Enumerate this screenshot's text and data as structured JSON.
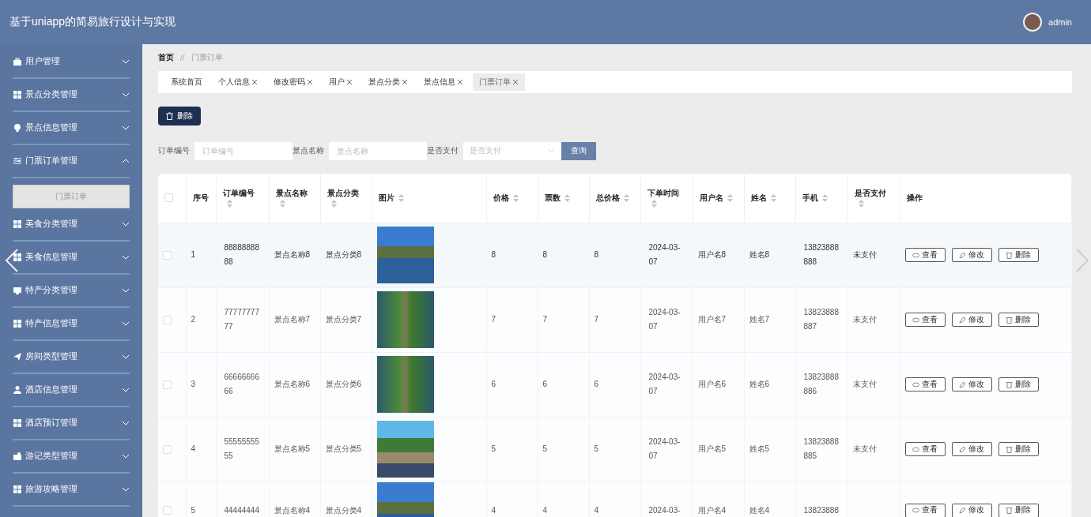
{
  "header": {
    "title": "基于uniapp的简易旅行设计与实现",
    "user": "admin"
  },
  "sidebar": {
    "items": [
      {
        "label": "用户管理",
        "expanded": false
      },
      {
        "label": "景点分类管理",
        "expanded": false
      },
      {
        "label": "景点信息管理",
        "expanded": false
      },
      {
        "label": "门票订单管理",
        "expanded": true,
        "children": [
          {
            "label": "门票订单",
            "selected": true
          }
        ]
      },
      {
        "label": "美食分类管理",
        "expanded": false
      },
      {
        "label": "美食信息管理",
        "expanded": false
      },
      {
        "label": "特产分类管理",
        "expanded": false
      },
      {
        "label": "特产信息管理",
        "expanded": false
      },
      {
        "label": "房间类型管理",
        "expanded": false
      },
      {
        "label": "酒店信息管理",
        "expanded": false
      },
      {
        "label": "酒店预订管理",
        "expanded": false
      },
      {
        "label": "游记类型管理",
        "expanded": false
      },
      {
        "label": "旅游攻略管理",
        "expanded": false
      }
    ]
  },
  "breadcrumb": [
    "首页",
    "门票订单"
  ],
  "breadcrumb_separator": "//",
  "tabs": [
    {
      "label": "系统首页",
      "closable": false,
      "selected": false
    },
    {
      "label": "个人信息",
      "closable": true,
      "selected": false
    },
    {
      "label": "修改密码",
      "closable": true,
      "selected": false
    },
    {
      "label": "用户",
      "closable": true,
      "selected": false
    },
    {
      "label": "景点分类",
      "closable": true,
      "selected": false
    },
    {
      "label": "景点信息",
      "closable": true,
      "selected": false
    },
    {
      "label": "门票订单",
      "closable": true,
      "selected": true
    }
  ],
  "delete_button": "删除",
  "filters": [
    {
      "label": "订单编号",
      "placeholder": "订单编号",
      "kind": "input"
    },
    {
      "label": "景点名称",
      "placeholder": "景点名称",
      "kind": "input"
    },
    {
      "label": "是否支付",
      "placeholder": "是否支付",
      "kind": "select"
    }
  ],
  "search_button": "查询",
  "table": {
    "select_all_checked": false,
    "columns": [
      {
        "label": "序号",
        "sortable": false
      },
      {
        "label": "订单编号",
        "sortable": true
      },
      {
        "label": "景点名称",
        "sortable": true
      },
      {
        "label": "景点分类",
        "sortable": true
      },
      {
        "label": "图片",
        "sortable": true
      },
      {
        "label": "价格",
        "sortable": true
      },
      {
        "label": "票数",
        "sortable": true
      },
      {
        "label": "总价格",
        "sortable": true
      },
      {
        "label": "下单时间",
        "sortable": true
      },
      {
        "label": "用户名",
        "sortable": true
      },
      {
        "label": "姓名",
        "sortable": true
      },
      {
        "label": "手机",
        "sortable": true
      },
      {
        "label": "是否支付",
        "sortable": true
      },
      {
        "label": "操作",
        "sortable": false
      }
    ],
    "rows": [
      {
        "checked": false,
        "cells": [
          "1",
          "8888888888",
          "景点名称8",
          "景点分类8",
          {
            "kind": "photo"
          },
          "8",
          "8",
          "8",
          "2024-03-07",
          "用户名8",
          "姓名8",
          "13823888888",
          "未支付"
        ],
        "actions": [
          "查看",
          "修改",
          "删除"
        ]
      },
      {
        "checked": false,
        "cells": [
          "2",
          "7777777777",
          "景点名称7",
          "景点分类7",
          {
            "kind": "photo"
          },
          "7",
          "7",
          "7",
          "2024-03-07",
          "用户名7",
          "姓名7",
          "13823888887",
          "未支付"
        ],
        "actions": [
          "查看",
          "修改",
          "删除"
        ]
      },
      {
        "checked": false,
        "cells": [
          "3",
          "6666666666",
          "景点名称6",
          "景点分类6",
          {
            "kind": "photo"
          },
          "6",
          "6",
          "6",
          "2024-03-07",
          "用户名6",
          "姓名6",
          "13823888886",
          "未支付"
        ],
        "actions": [
          "查看",
          "修改",
          "删除"
        ]
      },
      {
        "checked": false,
        "cells": [
          "4",
          "5555555555",
          "景点名称5",
          "景点分类5",
          {
            "kind": "photo"
          },
          "5",
          "5",
          "5",
          "2024-03-07",
          "用户名5",
          "姓名5",
          "13823888885",
          "未支付"
        ],
        "actions": [
          "查看",
          "修改",
          "删除"
        ]
      },
      {
        "checked": false,
        "cells": [
          "5",
          "44444444",
          "景点名称4",
          "景点分类4",
          {
            "kind": "photo"
          },
          "4",
          "4",
          "4",
          "2024-03-",
          "用户名4",
          "姓名4",
          "13823888"
        ],
        "actions": [
          "查看",
          "修改",
          "删除"
        ]
      }
    ]
  }
}
